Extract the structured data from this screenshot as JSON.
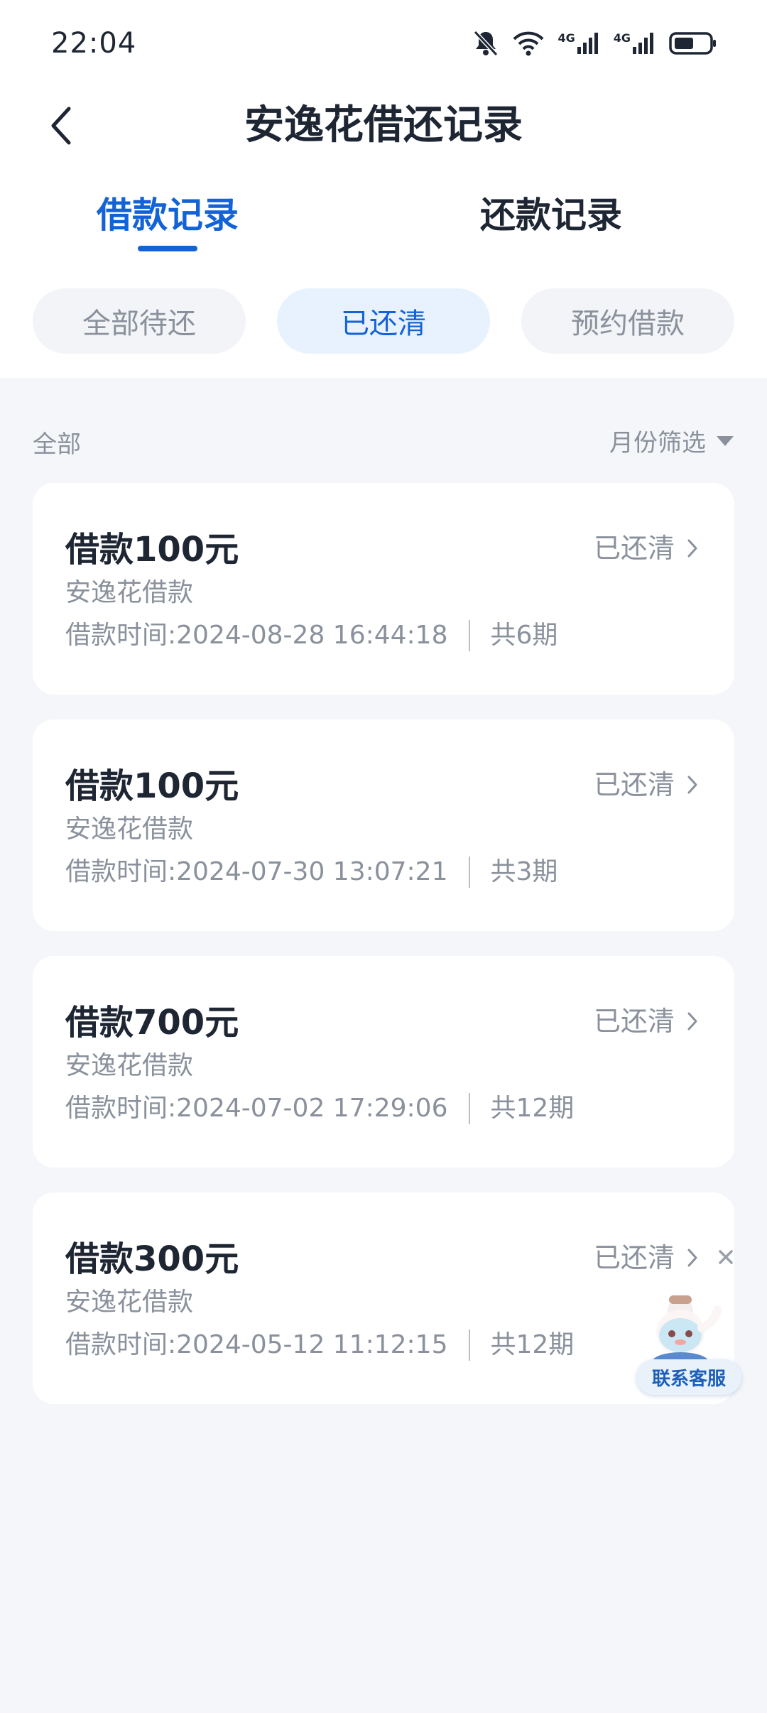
{
  "status_bar": {
    "time": "22:04",
    "icons": [
      "bell-muted-icon",
      "wifi-icon",
      "signal-4g-icon",
      "signal-4g-icon",
      "battery-icon"
    ],
    "network_label_1": "4G",
    "network_label_2": "4G",
    "battery_level_percent": 50
  },
  "nav": {
    "title": "安逸花借还记录",
    "back_icon": "chevron-left-icon"
  },
  "main_tabs": [
    {
      "label": "借款记录",
      "active": true
    },
    {
      "label": "还款记录",
      "active": false
    }
  ],
  "filter_chips": [
    {
      "label": "全部待还",
      "active": false
    },
    {
      "label": "已还清",
      "active": true
    },
    {
      "label": "预约借款",
      "active": false
    }
  ],
  "list_header": {
    "scope": "全部",
    "month_filter": "月份筛选",
    "month_filter_icon": "triangle-down-icon"
  },
  "records": [
    {
      "amount": "借款100元",
      "status": "已还清",
      "product": "安逸花借款",
      "time": "借款时间:2024-08-28 16:44:18",
      "periods": "共6期"
    },
    {
      "amount": "借款100元",
      "status": "已还清",
      "product": "安逸花借款",
      "time": "借款时间:2024-07-30 13:07:21",
      "periods": "共3期"
    },
    {
      "amount": "借款700元",
      "status": "已还清",
      "product": "安逸花借款",
      "time": "借款时间:2024-07-02 17:29:06",
      "periods": "共12期"
    },
    {
      "amount": "借款300元",
      "status": "已还清",
      "product": "安逸花借款",
      "time": "借款时间:2024-05-12 11:12:15",
      "periods": "共12期"
    }
  ],
  "customer_service": {
    "label": "联系客服",
    "close_icon": "close-icon",
    "avatar": "mascot-avatar"
  },
  "colors": {
    "accent": "#1463d6",
    "text_primary": "#1e2633",
    "text_secondary": "#8a919c",
    "background": "#f4f6f9",
    "chip_active_bg": "#e8f2ff"
  }
}
